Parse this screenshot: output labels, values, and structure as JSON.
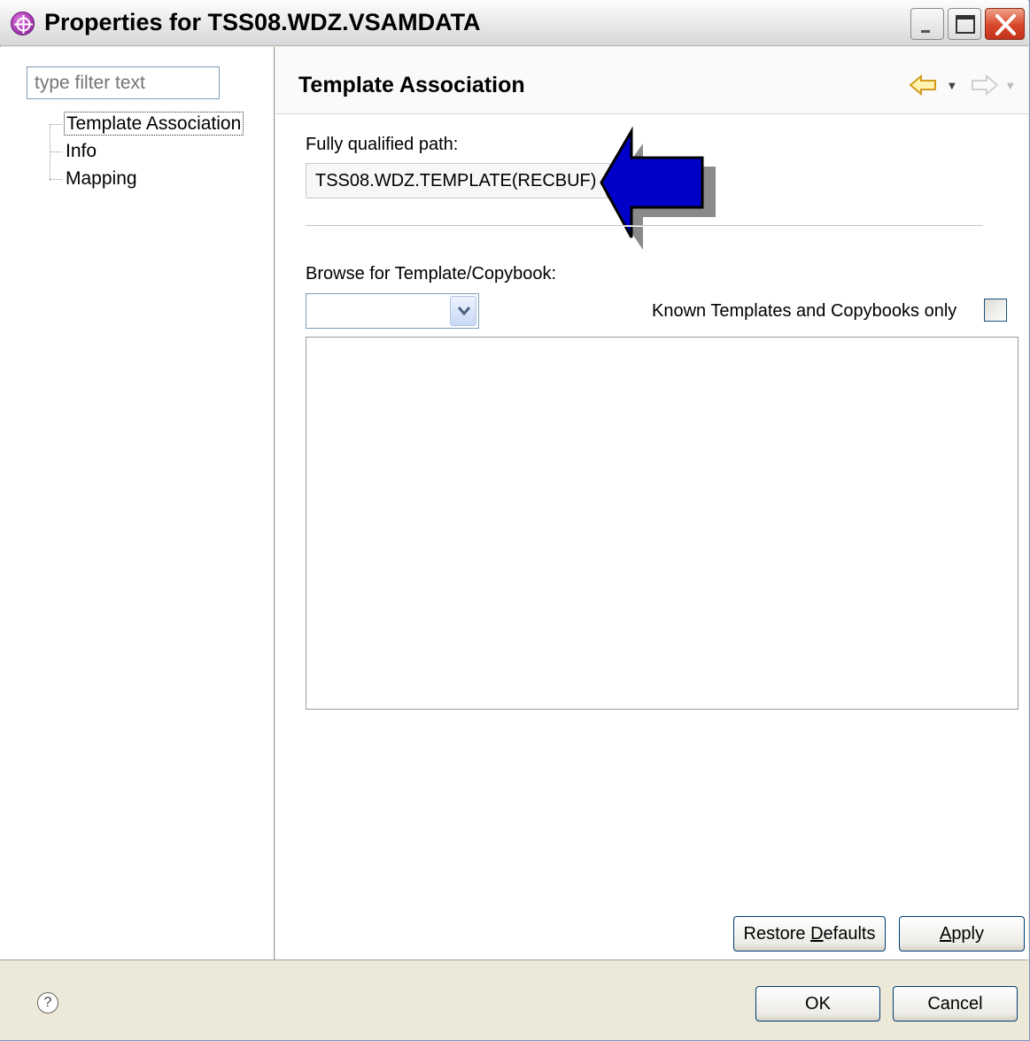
{
  "window": {
    "title": "Properties for TSS08.WDZ.VSAMDATA",
    "buttons": {
      "minimize": "minimize",
      "maximize": "maximize",
      "close": "close"
    }
  },
  "sidebar": {
    "filter_placeholder": "type filter text",
    "items": [
      {
        "label": "Template Association",
        "selected": true
      },
      {
        "label": "Info",
        "selected": false
      },
      {
        "label": "Mapping",
        "selected": false
      }
    ]
  },
  "page": {
    "title": "Template Association",
    "path_label": "Fully qualified path:",
    "path_value": "TSS08.WDZ.TEMPLATE(RECBUF)",
    "browse_label": "Browse for Template/Copybook:",
    "browse_value": "",
    "known_only_label": "Known Templates and Copybooks only",
    "known_only_checked": false
  },
  "buttons": {
    "restore_prefix": "Restore ",
    "restore_mnemonic": "D",
    "restore_suffix": "efaults",
    "apply_mnemonic": "A",
    "apply_suffix": "pply",
    "ok": "OK",
    "cancel": "Cancel"
  },
  "colors": {
    "arrow_fill": "#0000c8",
    "arrow_shadow": "#8a8a8a",
    "title_icon": "#9b2ea8",
    "close_button": "#d8472a"
  },
  "icons": {
    "title": "eclipse-properties-icon",
    "back": "back-arrow-icon",
    "forward": "forward-arrow-icon",
    "help": "help-icon",
    "pointer": "blue-pointer-arrow"
  }
}
